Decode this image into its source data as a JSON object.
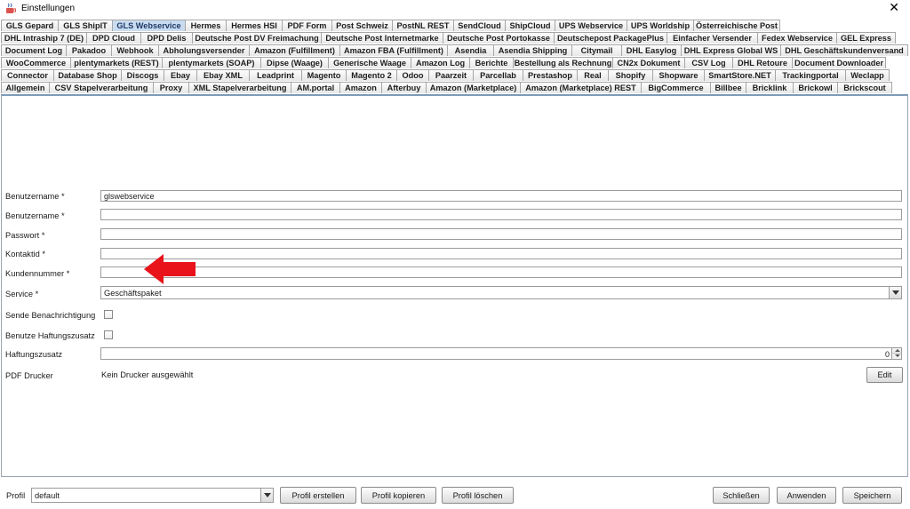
{
  "window": {
    "title": "Einstellungen",
    "close_glyph": "✕"
  },
  "tabs": {
    "rows": [
      [
        "GLS Gepard",
        "GLS ShipIT",
        "GLS Webservice",
        "Hermes",
        "Hermes HSI",
        "PDF Form",
        "Post Schweiz",
        "PostNL REST",
        "SendCloud",
        "ShipCloud",
        "UPS Webservice",
        "UPS Worldship",
        "Österreichische Post"
      ],
      [
        "DHL Intraship 7 (DE)",
        "DPD Cloud",
        "DPD Delis",
        "Deutsche Post DV Freimachung",
        "Deutsche Post Internetmarke",
        "Deutsche Post Portokasse",
        "Deutschepost PackagePlus",
        "Einfacher Versender",
        "Fedex Webservice",
        "GEL Express"
      ],
      [
        "Document Log",
        "Pakadoo",
        "Webhook",
        "Abholungsversender",
        "Amazon (Fulfillment)",
        "Amazon FBA (Fulfillment)",
        "Asendia",
        "Asendia Shipping",
        "Citymail",
        "DHL Easylog",
        "DHL Express Global WS",
        "DHL Geschäftskundenversand"
      ],
      [
        "WooCommerce",
        "plentymarkets (REST)",
        "plentymarkets (SOAP)",
        "Dipse (Waage)",
        "Generische Waage",
        "Amazon Log",
        "Berichte",
        "Bestellung als Rechnung",
        "CN2x Dokument",
        "CSV Log",
        "DHL Retoure",
        "Document Downloader"
      ],
      [
        "Connector",
        "Database Shop",
        "Discogs",
        "Ebay",
        "Ebay XML",
        "Leadprint",
        "Magento",
        "Magento 2",
        "Odoo",
        "Paarzeit",
        "Parcellab",
        "Prestashop",
        "Real",
        "Shopify",
        "Shopware",
        "SmartStore.NET",
        "Trackingportal",
        "Weclapp"
      ],
      [
        "Allgemein",
        "CSV Stapelverarbeitung",
        "Proxy",
        "XML Stapelverarbeitung",
        "AM.portal",
        "Amazon",
        "Afterbuy",
        "Amazon (Marketplace)",
        "Amazon (Marketplace) REST",
        "BigCommerce",
        "Billbee",
        "Bricklink",
        "Brickowl",
        "Brickscout"
      ]
    ],
    "active": "GLS Webservice"
  },
  "form": {
    "username1": {
      "label": "Benutzername *",
      "value": "glswebservice"
    },
    "username2": {
      "label": "Benutzername *",
      "value": ""
    },
    "password": {
      "label": "Passwort *",
      "value": ""
    },
    "contact_id": {
      "label": "Kontaktid *",
      "value": ""
    },
    "customer_number": {
      "label": "Kundennummer *",
      "value": ""
    },
    "service": {
      "label": "Service *",
      "value": "Geschäftspaket"
    },
    "send_notification": {
      "label": "Sende Benachrichtigung",
      "checked": false
    },
    "use_liability": {
      "label": "Benutze Haftungszusatz",
      "checked": false
    },
    "liability": {
      "label": "Haftungszusatz",
      "value": "0"
    },
    "pdf_printer": {
      "label": "PDF Drucker",
      "value": "Kein Drucker ausgewählt",
      "edit_label": "Edit"
    }
  },
  "bottom": {
    "profil_label": "Profil",
    "profil_value": "default",
    "create_label": "Profil erstellen",
    "copy_label": "Profil kopieren",
    "delete_label": "Profil löschen",
    "close_label": "Schließen",
    "apply_label": "Anwenden",
    "save_label": "Speichern"
  },
  "colors": {
    "annotation_arrow": "#e8131b",
    "active_tab": "#c9dcf0"
  },
  "icons": {
    "app": "java-cup-icon",
    "close": "close-icon",
    "annotation": "red-arrow-icon"
  }
}
